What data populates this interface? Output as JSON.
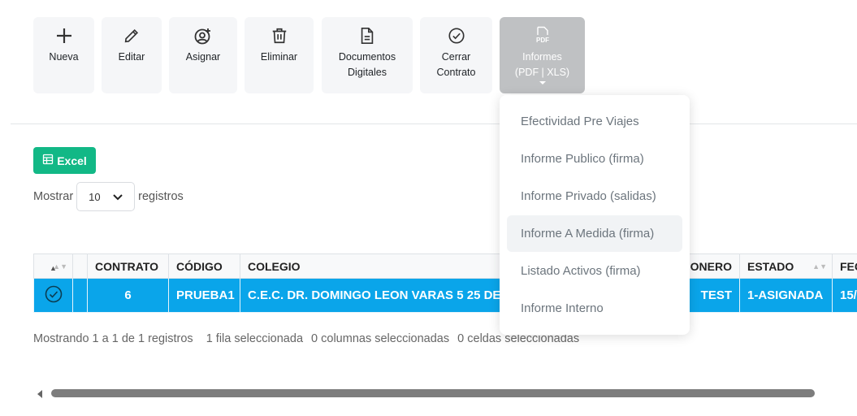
{
  "toolbar": {
    "buttons": [
      {
        "line1": "Nueva",
        "line2": ""
      },
      {
        "line1": "Editar",
        "line2": ""
      },
      {
        "line1": "Asignar",
        "line2": ""
      },
      {
        "line1": "Eliminar",
        "line2": ""
      },
      {
        "line1": "Documentos",
        "line2": "Digitales"
      },
      {
        "line1": "Cerrar",
        "line2": "Contrato"
      },
      {
        "line1": "Informes",
        "line2": "(PDF | XLS)",
        "icon_text": "PDF"
      }
    ]
  },
  "excel": {
    "label": "Excel"
  },
  "length": {
    "prefix": "Mostrar",
    "value": "10",
    "suffix": "registros"
  },
  "table": {
    "headers": [
      "CONTRATO",
      "CÓDIGO",
      "COLEGIO",
      "ONERO",
      "ESTADO",
      "FEC"
    ],
    "row": {
      "contrato": "6",
      "codigo": "PRUEBA1",
      "colegio": "C.E.C. DR. DOMINGO LEON VARAS 5 25 DE",
      "onero": "TEST",
      "estado": "1-ASIGNADA",
      "fecha": "15/"
    }
  },
  "info": {
    "records": "Mostrando 1 a 1 de 1 registros",
    "rows": "1 fila seleccionada",
    "cols": "0 columnas seleccionadas",
    "cells": "0 celdas seleccionadas"
  },
  "dropdown": {
    "items": [
      "Efectividad Pre Viajes",
      "Informe Publico (firma)",
      "Informe Privado (salidas)",
      "Informe A Medida (firma)",
      "Listado Activos (firma)",
      "Informe Interno"
    ]
  },
  "colors": {
    "accent": "#0aa5ea",
    "excel": "#12b886",
    "active_button": "#bfc1c3"
  }
}
